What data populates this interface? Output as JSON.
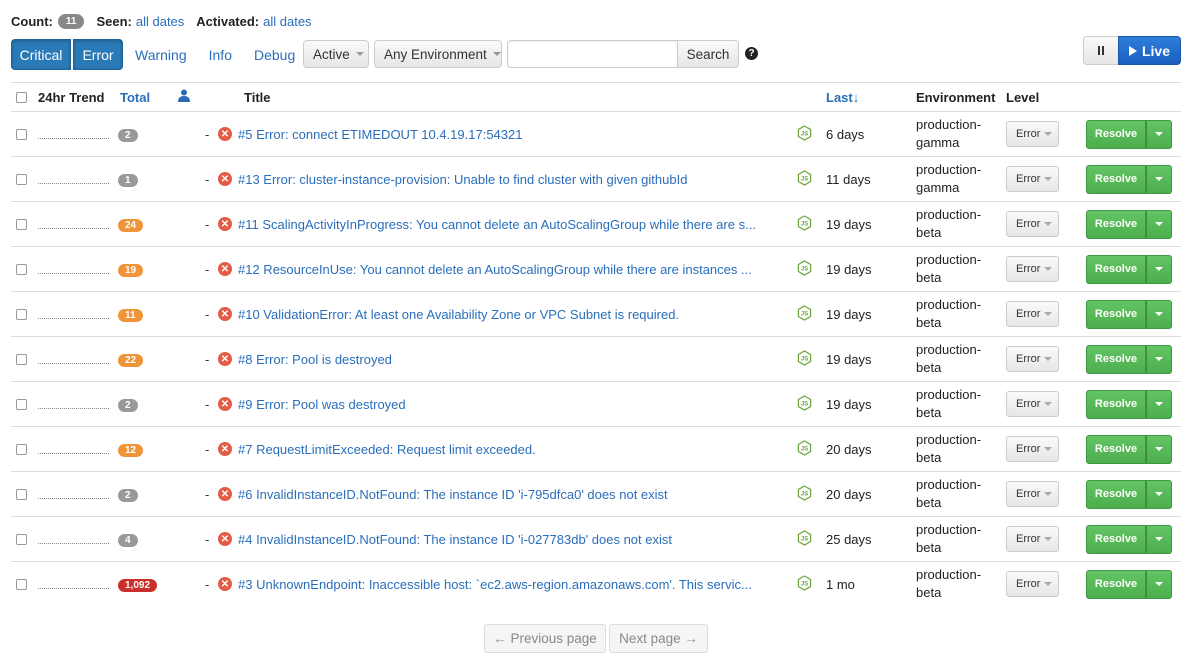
{
  "summary": {
    "count_label": "Count:",
    "count_value": "11",
    "seen_label": "Seen:",
    "seen_value": "all dates",
    "activated_label": "Activated:",
    "activated_value": "all dates"
  },
  "levels": {
    "critical": "Critical",
    "error": "Error",
    "warning": "Warning",
    "info": "Info",
    "debug": "Debug"
  },
  "filters": {
    "status": "Active",
    "environment": "Any Environment",
    "search_value": "",
    "search_button": "Search",
    "help_glyph": "?"
  },
  "live": {
    "live_label": "Live"
  },
  "table": {
    "headers": {
      "trend": "24hr Trend",
      "total": "Total",
      "assignee_icon": "user-icon",
      "title": "Title",
      "last": "Last",
      "environment": "Environment",
      "level": "Level"
    },
    "rows": [
      {
        "total": "2",
        "badge": "gray",
        "assignee": "-",
        "title": "#5 Error: connect ETIMEDOUT 10.4.19.17:54321",
        "last": "6 days",
        "env_line1": "production-",
        "env_line2": "gamma",
        "level": "Error",
        "action": "Resolve"
      },
      {
        "total": "1",
        "badge": "gray",
        "assignee": "-",
        "title": "#13 Error: cluster-instance-provision: Unable to find cluster with given githubId",
        "last": "11 days",
        "env_line1": "production-",
        "env_line2": "gamma",
        "level": "Error",
        "action": "Resolve"
      },
      {
        "total": "24",
        "badge": "orange",
        "assignee": "-",
        "title": "#11 ScalingActivityInProgress: You cannot delete an AutoScalingGroup while there are s...",
        "last": "19 days",
        "env_line1": "production-",
        "env_line2": "beta",
        "level": "Error",
        "action": "Resolve"
      },
      {
        "total": "19",
        "badge": "orange",
        "assignee": "-",
        "title": "#12 ResourceInUse: You cannot delete an AutoScalingGroup while there are instances ...",
        "last": "19 days",
        "env_line1": "production-",
        "env_line2": "beta",
        "level": "Error",
        "action": "Resolve"
      },
      {
        "total": "11",
        "badge": "orange",
        "assignee": "-",
        "title": "#10 ValidationError: At least one Availability Zone or VPC Subnet is required.",
        "last": "19 days",
        "env_line1": "production-",
        "env_line2": "beta",
        "level": "Error",
        "action": "Resolve"
      },
      {
        "total": "22",
        "badge": "orange",
        "assignee": "-",
        "title": "#8 Error: Pool is destroyed",
        "last": "19 days",
        "env_line1": "production-",
        "env_line2": "beta",
        "level": "Error",
        "action": "Resolve"
      },
      {
        "total": "2",
        "badge": "gray",
        "assignee": "-",
        "title": "#9 Error: Pool was destroyed",
        "last": "19 days",
        "env_line1": "production-",
        "env_line2": "beta",
        "level": "Error",
        "action": "Resolve"
      },
      {
        "total": "12",
        "badge": "orange",
        "assignee": "-",
        "title": "#7 RequestLimitExceeded: Request limit exceeded.",
        "last": "20 days",
        "env_line1": "production-",
        "env_line2": "beta",
        "level": "Error",
        "action": "Resolve"
      },
      {
        "total": "2",
        "badge": "gray",
        "assignee": "-",
        "title": "#6 InvalidInstanceID.NotFound: The instance ID 'i-795dfca0' does not exist",
        "last": "20 days",
        "env_line1": "production-",
        "env_line2": "beta",
        "level": "Error",
        "action": "Resolve"
      },
      {
        "total": "4",
        "badge": "gray",
        "assignee": "-",
        "title": "#4 InvalidInstanceID.NotFound: The instance ID 'i-027783db' does not exist",
        "last": "25 days",
        "env_line1": "production-",
        "env_line2": "beta",
        "level": "Error",
        "action": "Resolve"
      },
      {
        "total": "1,092",
        "badge": "red",
        "assignee": "-",
        "title": "#3 UnknownEndpoint: Inaccessible host: `ec2.aws-region.amazonaws.com'. This servic...",
        "last": "1 mo",
        "env_line1": "production-",
        "env_line2": "beta",
        "level": "Error",
        "action": "Resolve"
      }
    ]
  },
  "pagination": {
    "previous": "← Previous page",
    "next": "Next page →"
  },
  "colors": {
    "accent": "#2a7ab7",
    "link": "#2a6ebb",
    "resolve_green": "#5cb85c",
    "badge_gray": "#999999",
    "badge_orange": "#f0943a",
    "badge_red": "#c9302c",
    "error_icon": "#e35c46",
    "nodejs_icon": "#6aa53b"
  }
}
